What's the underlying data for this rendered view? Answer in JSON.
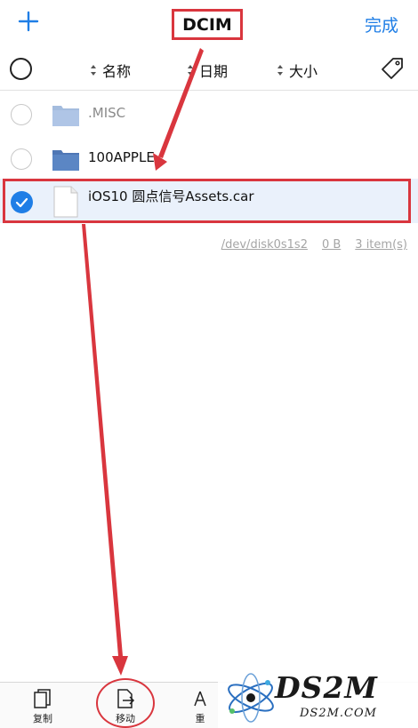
{
  "header": {
    "title": "DCIM",
    "done_label": "完成"
  },
  "sort_bar": {
    "name_label": "名称",
    "date_label": "日期",
    "size_label": "大小"
  },
  "files": [
    {
      "name": ".MISC",
      "type": "folder",
      "state": "muted"
    },
    {
      "name": "100APPLE",
      "type": "folder",
      "state": "normal"
    },
    {
      "name": "iOS10 圆点信号Assets.car",
      "type": "file",
      "state": "selected"
    }
  ],
  "info": {
    "path": "/dev/disk0s1s2",
    "size": "0 B",
    "count": "3 item(s)"
  },
  "toolbar": {
    "copy_label": "复制",
    "move_label": "移动",
    "rename_label": "重"
  },
  "watermark": {
    "main": "DS2M",
    "sub": "DS2M.COM"
  },
  "colors": {
    "accent": "#1f7ee6",
    "annotation": "#d9363e",
    "selected_bg": "#eaf1fb",
    "folder": "#5b86c4"
  }
}
